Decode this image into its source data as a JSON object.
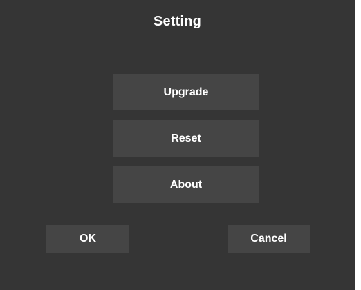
{
  "dialog": {
    "title": "Setting",
    "menu": {
      "upgrade_label": "Upgrade",
      "reset_label": "Reset",
      "about_label": "About"
    },
    "actions": {
      "ok_label": "OK",
      "cancel_label": "Cancel"
    }
  },
  "colors": {
    "background": "#353535",
    "button": "#454545",
    "text": "#ffffff"
  }
}
